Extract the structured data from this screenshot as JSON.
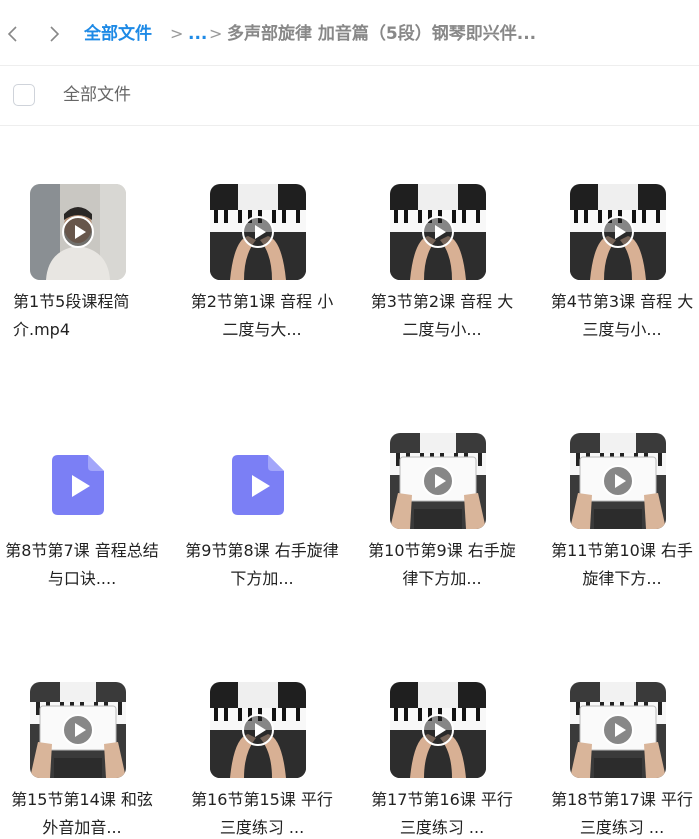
{
  "nav": {
    "back_icon": "chevron-left-icon",
    "forward_icon": "chevron-right-icon"
  },
  "breadcrumb": {
    "root": "全部文件",
    "separator": ">",
    "ellipsis": "...",
    "current": "多声部旋律 加音篇（5段）钢琴即兴伴..."
  },
  "selectbar": {
    "label": "全部文件"
  },
  "colors": {
    "accent": "#1e8ae6",
    "video_icon": "#7b7ff5"
  },
  "files": [
    {
      "name": "第1节5段课程简介.mp4",
      "thumb": "person"
    },
    {
      "name": "第2节第1课 音程 小二度与大...",
      "thumb": "piano-hands"
    },
    {
      "name": "第3节第2课 音程 大二度与小...",
      "thumb": "piano-hands"
    },
    {
      "name": "第4节第3课 音程 大三度与小...",
      "thumb": "piano-hands"
    },
    {
      "name": "第8节第7课 音程总结与口诀....",
      "thumb": "video-file-icon"
    },
    {
      "name": "第9节第8课 右手旋律下方加...",
      "thumb": "video-file-icon"
    },
    {
      "name": "第10节第9课 右手旋律下方加...",
      "thumb": "piano-board"
    },
    {
      "name": "第11节第10课 右手旋律下方...",
      "thumb": "piano-board"
    },
    {
      "name": "第15节第14课 和弦外音加音...",
      "thumb": "piano-board"
    },
    {
      "name": "第16节第15课 平行三度练习 ...",
      "thumb": "piano-hands"
    },
    {
      "name": "第17节第16课 平行三度练习 ...",
      "thumb": "piano-hands"
    },
    {
      "name": "第18节第17课 平行三度练习 ...",
      "thumb": "piano-board"
    }
  ]
}
